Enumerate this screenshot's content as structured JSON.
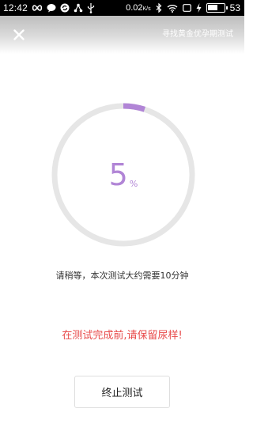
{
  "status_bar": {
    "time": "12:42",
    "left_icons": [
      "infinity-icon",
      "chat-bubble-icon",
      "sync-icon",
      "share-icon",
      "usb-icon"
    ],
    "speed": "0.02",
    "speed_unit": "K/s",
    "right_icons": [
      "bluetooth-icon",
      "wifi-icon",
      "screen-icon",
      "charging-icon",
      "battery-icon"
    ],
    "battery_level": "53"
  },
  "header": {
    "link_label": "寻找黄金优孕期测试"
  },
  "progress": {
    "value": "5",
    "unit": "%",
    "fraction": 0.05,
    "accent_color": "#b185d6",
    "track_color": "#e6e6e6"
  },
  "messages": {
    "wait": "请稍等，本次测试大约需要10分钟",
    "warning": "在测试完成前,请保留尿样!",
    "warning_color": "#e84a4a"
  },
  "actions": {
    "stop_label": "终止测试"
  }
}
